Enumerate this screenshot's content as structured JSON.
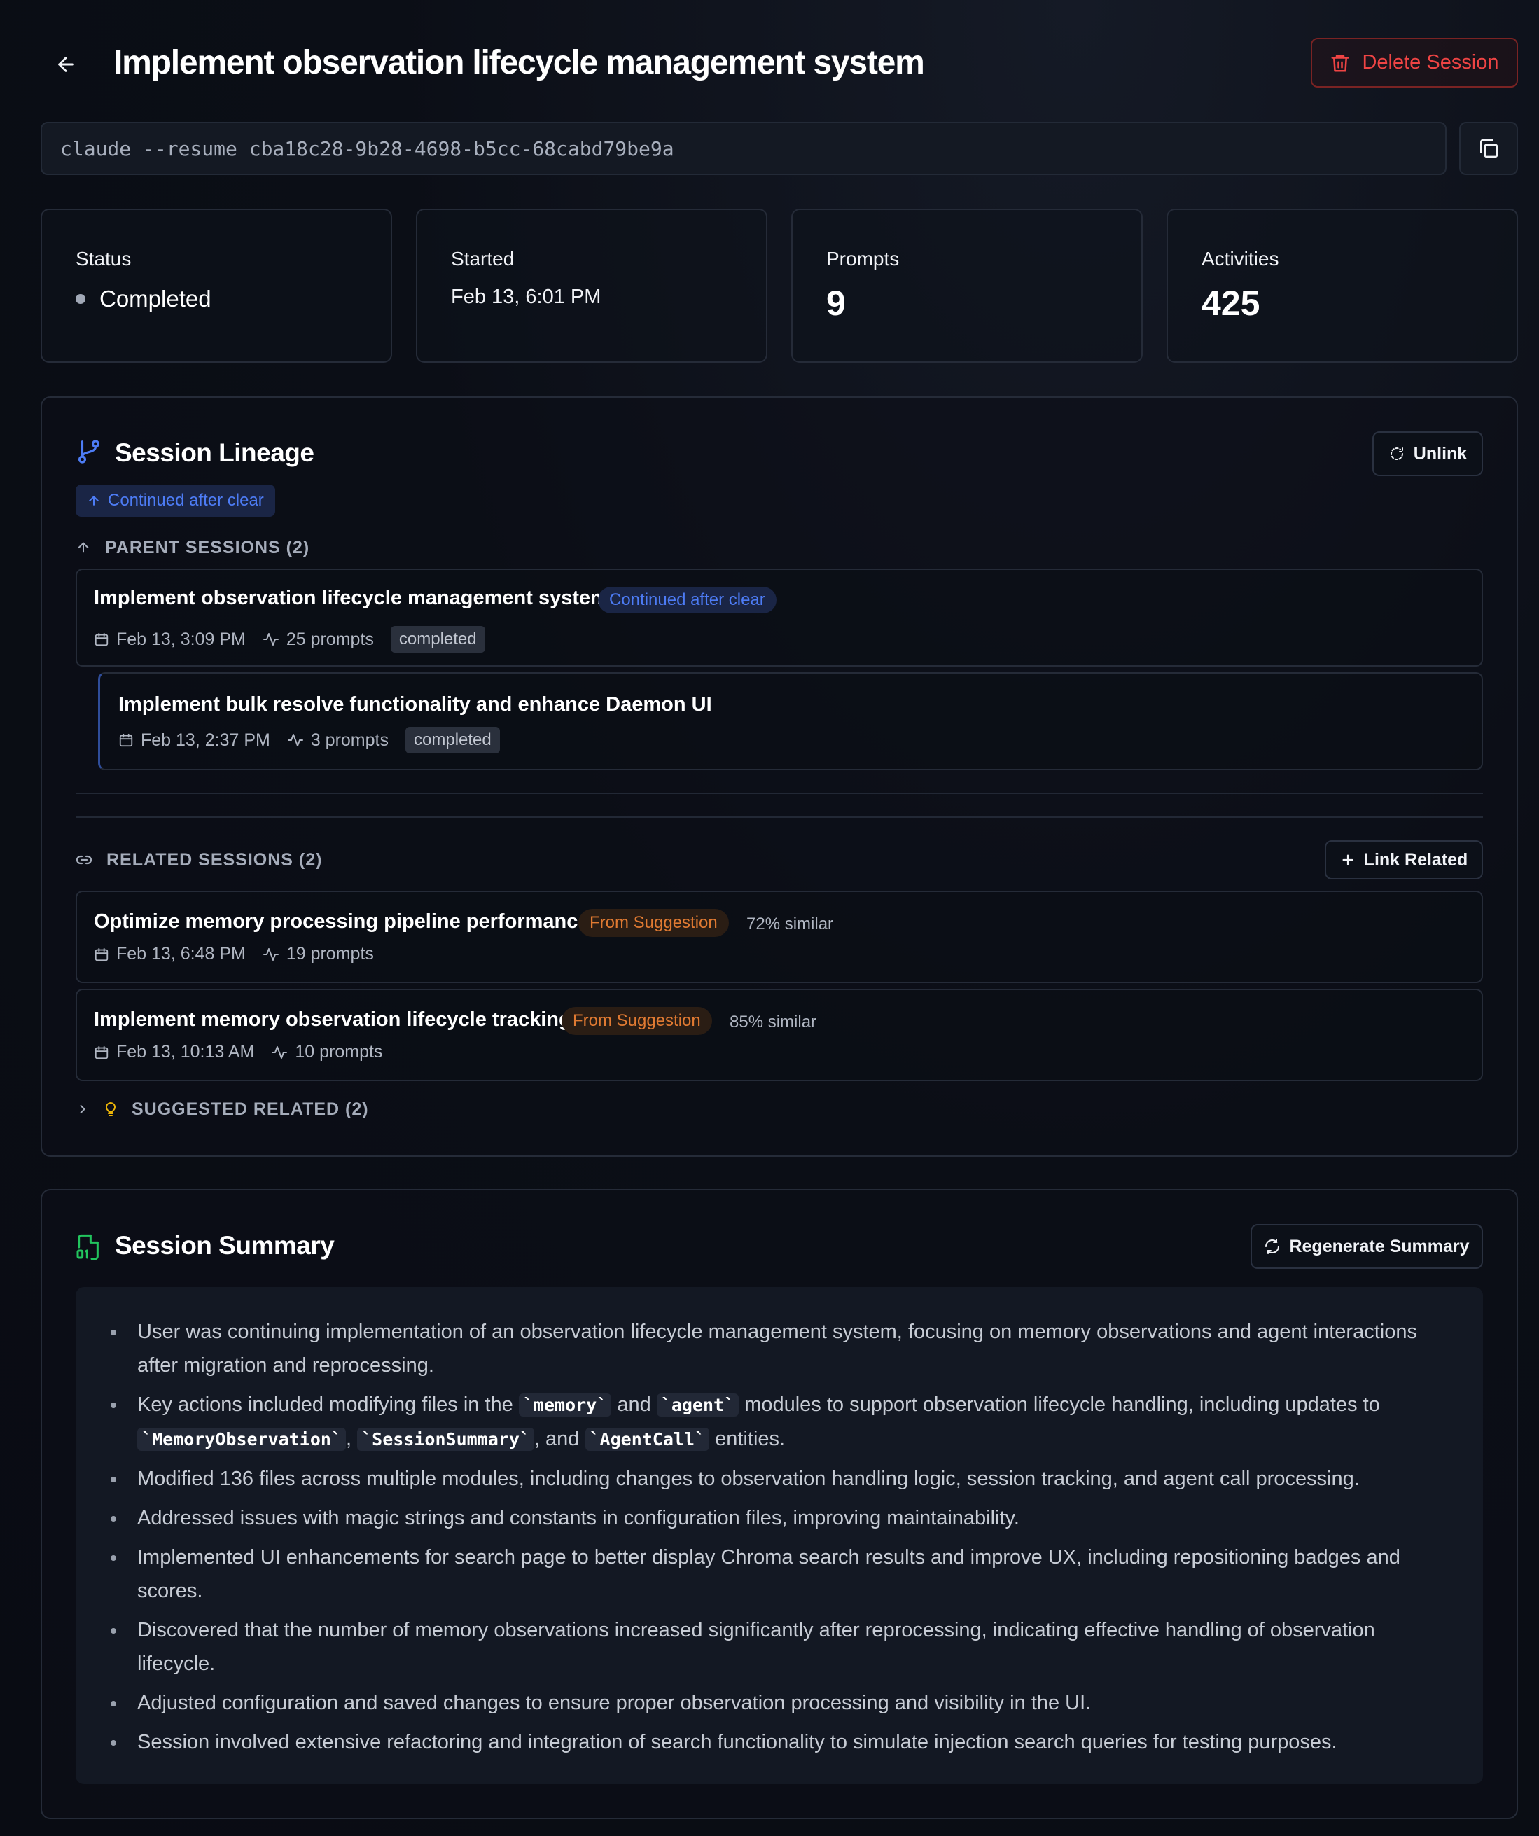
{
  "header": {
    "title": "Implement observation lifecycle management system",
    "delete_label": "Delete Session"
  },
  "command": {
    "text": "claude --resume cba18c28-9b28-4698-b5cc-68cabd79be9a"
  },
  "stats": {
    "status_label": "Status",
    "status_value": "Completed",
    "started_label": "Started",
    "started_value": "Feb 13, 6:01 PM",
    "prompts_label": "Prompts",
    "prompts_value": "9",
    "activities_label": "Activities",
    "activities_value": "425"
  },
  "lineage": {
    "title": "Session Lineage",
    "unlink_label": "Unlink",
    "continued_badge": "Continued after clear",
    "parent_label": "PARENT SESSIONS (2)",
    "parents": [
      {
        "title": "Implement observation lifecycle management system",
        "badge": "Continued after clear",
        "date": "Feb 13, 3:09 PM",
        "prompts": "25 prompts",
        "status": "completed"
      },
      {
        "title": "Implement bulk resolve functionality and enhance Daemon UI",
        "date": "Feb 13, 2:37 PM",
        "prompts": "3 prompts",
        "status": "completed"
      }
    ],
    "related_label": "RELATED SESSIONS (2)",
    "link_related_label": "Link Related",
    "related": [
      {
        "title": "Optimize memory processing pipeline performance",
        "badge": "From Suggestion",
        "similarity": "72% similar",
        "date": "Feb 13, 6:48 PM",
        "prompts": "19 prompts"
      },
      {
        "title": "Implement memory observation lifecycle tracking",
        "badge": "From Suggestion",
        "similarity": "85% similar",
        "date": "Feb 13, 10:13 AM",
        "prompts": "10 prompts"
      }
    ],
    "suggested_label": "SUGGESTED RELATED (2)"
  },
  "summary": {
    "title": "Session Summary",
    "regenerate_label": "Regenerate Summary",
    "item1": "User was continuing implementation of an observation lifecycle management system, focusing on memory observations and agent interactions after migration and reprocessing.",
    "item2_parts": {
      "a": "Key actions included modifying files in the ",
      "code1": "`memory`",
      "b": " and ",
      "code2": "`agent`",
      "c": " modules to support observation lifecycle handling, including updates to ",
      "code3": "`MemoryObservation`",
      "d": ", ",
      "code4": "`SessionSummary`",
      "e": ", and ",
      "code5": "`AgentCall`",
      "f": " entities."
    },
    "item3": "Modified 136 files across multiple modules, including changes to observation handling logic, session tracking, and agent call processing.",
    "item4": "Addressed issues with magic strings and constants in configuration files, improving maintainability.",
    "item5": "Implemented UI enhancements for search page to better display Chroma search results and improve UX, including repositioning badges and scores.",
    "item6": "Discovered that the number of memory observations increased significantly after reprocessing, indicating effective handling of observation lifecycle.",
    "item7": "Adjusted configuration and saved changes to ensure proper observation processing and visibility in the UI.",
    "item8": "Session involved extensive refactoring and integration of search functionality to simulate injection search queries for testing purposes."
  },
  "colors": {
    "accent_blue": "#4d7cf5",
    "danger_red": "#ef4444",
    "suggestion_orange": "#e07a32",
    "summary_icon_green": "#22c55e",
    "suggest_icon_yellow": "#eab308"
  }
}
